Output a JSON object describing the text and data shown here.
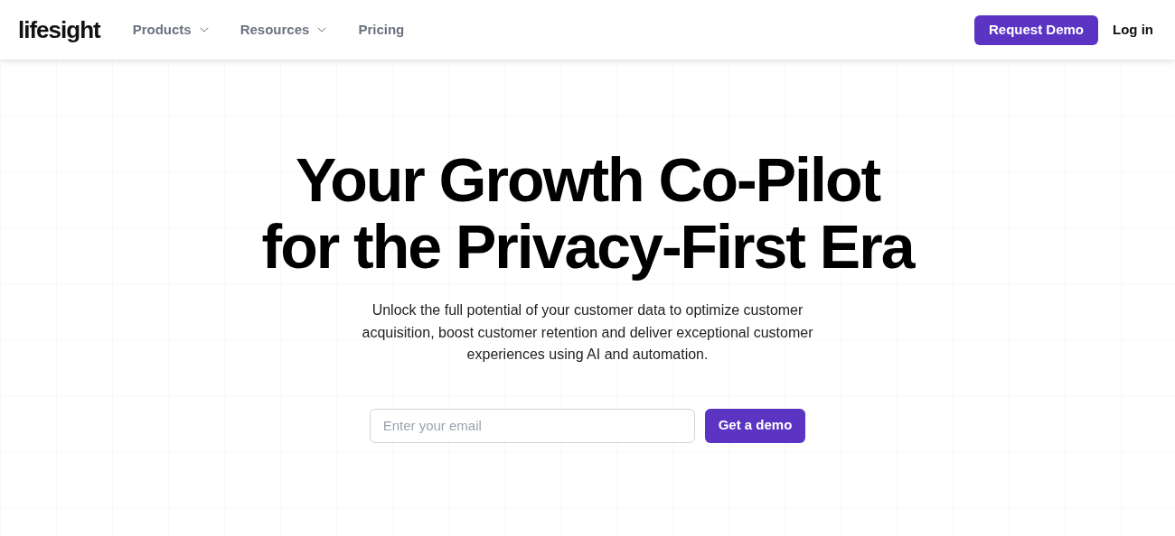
{
  "header": {
    "logo": "lifesight",
    "nav": [
      {
        "label": "Products",
        "kind": "dropdown"
      },
      {
        "label": "Resources",
        "kind": "dropdown"
      },
      {
        "label": "Pricing",
        "kind": "link"
      }
    ],
    "request_demo": "Request Demo",
    "login": "Log in"
  },
  "hero": {
    "headline": [
      "Your Growth Co-Pilot",
      "for the Privacy-First Era"
    ],
    "description": "Unlock the full potential of your customer data to optimize customer acquisition, boost customer retention and deliver exceptional customer experiences using AI and automation.",
    "email": {
      "placeholder": "Enter your email"
    },
    "cta": "Get a demo"
  }
}
